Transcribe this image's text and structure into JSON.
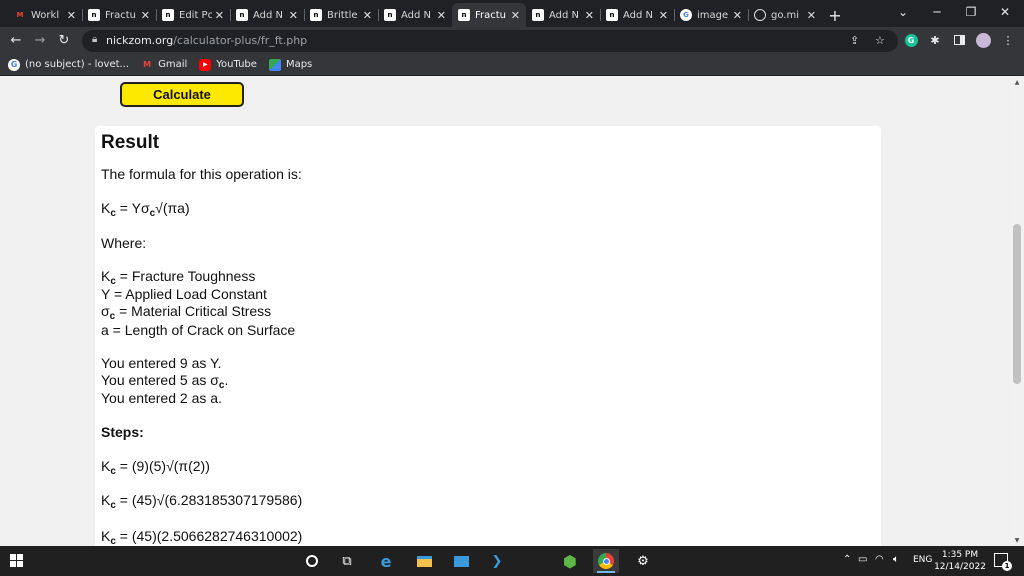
{
  "tabs": [
    {
      "label": "Workl",
      "icon": "gmail-icon"
    },
    {
      "label": "Fractu",
      "icon": "nickzom-icon"
    },
    {
      "label": "Edit Pc",
      "icon": "nickzom-icon"
    },
    {
      "label": "Add N",
      "icon": "nickzom-icon"
    },
    {
      "label": "Brittle",
      "icon": "nickzom-icon"
    },
    {
      "label": "Add N",
      "icon": "nickzom-icon"
    },
    {
      "label": "Fractu",
      "icon": "nickzom-icon"
    },
    {
      "label": "Add N",
      "icon": "nickzom-icon"
    },
    {
      "label": "Add N",
      "icon": "nickzom-icon"
    },
    {
      "label": "image",
      "icon": "google-icon"
    },
    {
      "label": "go.mi",
      "icon": "globe-icon"
    }
  ],
  "active_tab": 6,
  "address": {
    "domain": "nickzom.org",
    "path": "/calculator-plus/fr_ft.php"
  },
  "bookmarks": [
    {
      "label": "(no subject) - lovet...",
      "icon": "google-icon"
    },
    {
      "label": "Gmail",
      "icon": "gmail-icon"
    },
    {
      "label": "YouTube",
      "icon": "youtube-icon"
    },
    {
      "label": "Maps",
      "icon": "maps-icon"
    }
  ],
  "page": {
    "calculate_label": "Calculate",
    "result_title": "Result",
    "formula_intro": "The formula for this operation is:",
    "formula": {
      "lhs": "K",
      "lhs_sub": "c",
      "a": " = Yσ",
      "a_sub": "c",
      "b": "√(πa)"
    },
    "where_label": "Where:",
    "definitions": [
      {
        "sym": "K",
        "sub": "c",
        "text": " = Fracture Toughness"
      },
      {
        "sym": "Y",
        "sub": "",
        "text": " = Applied Load Constant"
      },
      {
        "sym": "σ",
        "sub": "c",
        "text": " = Material Critical Stress"
      },
      {
        "sym": "a",
        "sub": "",
        "text": " = Length of Crack on Surface"
      }
    ],
    "entered": {
      "y": "You entered 9 as Y.",
      "sigma_pre": "You entered 5 as σ",
      "sigma_sub": "c",
      "sigma_post": ".",
      "a": "You entered 2 as a."
    },
    "steps_label": "Steps:",
    "steps": [
      {
        "lhs": "K",
        "sub": "c",
        "rhs": " = (9)(5)√(π(2))"
      },
      {
        "lhs": "K",
        "sub": "c",
        "rhs": " = (45)√(6.283185307179586)"
      },
      {
        "lhs": "K",
        "sub": "c",
        "rhs": " = (45)(2.5066282746310002)"
      }
    ]
  },
  "taskbar": {
    "tray_lang": "ENG",
    "clock_time": "1:35 PM",
    "clock_date": "12/14/2022",
    "notification_count": "1"
  },
  "colors": {
    "calculate_bg": "#fde800",
    "chrome_dark": "#202124",
    "chrome_toolbar": "#35363a",
    "page_bg": "#f0f0f0"
  }
}
